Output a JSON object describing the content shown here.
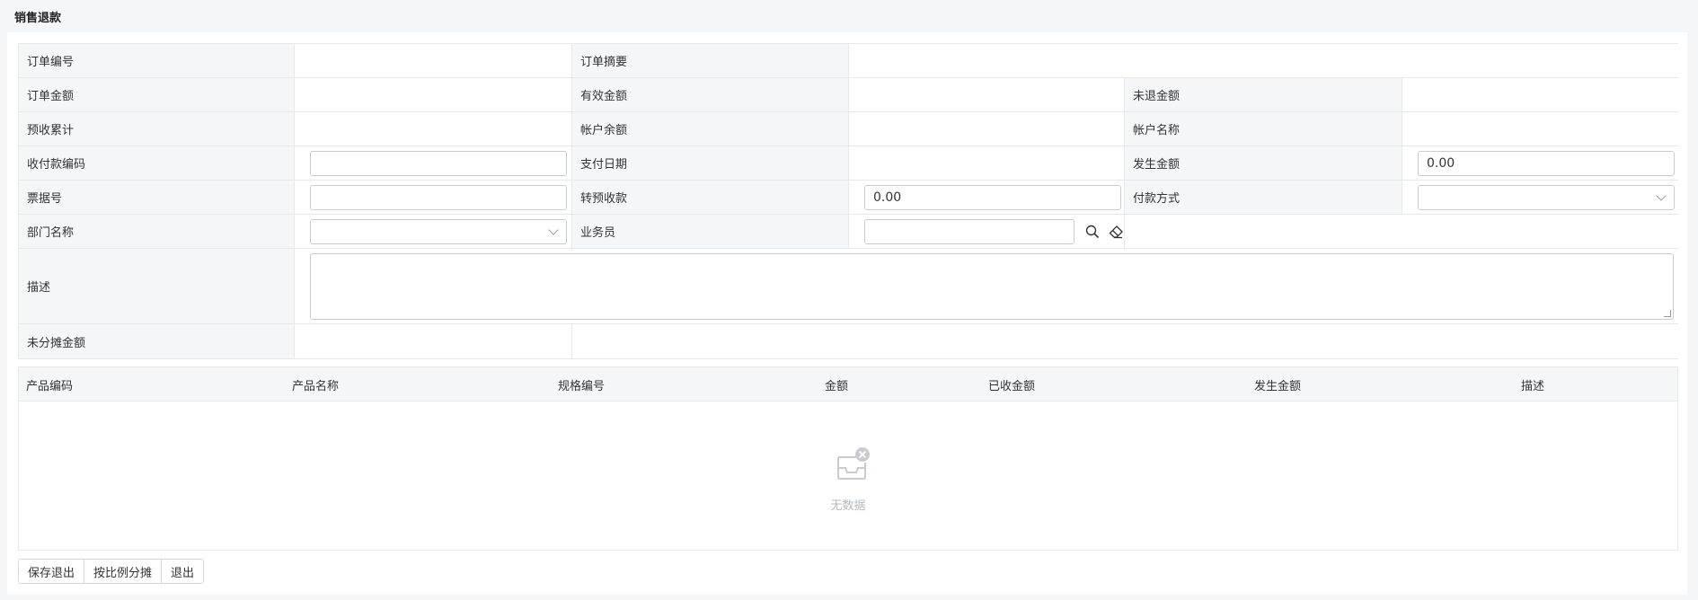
{
  "page": {
    "title": "销售退款"
  },
  "form": {
    "order_no_label": "订单编号",
    "order_summary_label": "订单摘要",
    "order_amount_label": "订单金额",
    "valid_amount_label": "有效金额",
    "unrefunded_amount_label": "未退金额",
    "prepaid_total_label": "预收累计",
    "account_balance_label": "帐户余额",
    "account_name_label": "帐户名称",
    "payment_code_label": "收付款编码",
    "payment_date_label": "支付日期",
    "occur_amount_label": "发生金额",
    "occur_amount_value": "0.00",
    "bill_no_label": "票据号",
    "transfer_prepaid_label": "转预收款",
    "transfer_prepaid_value": "0.00",
    "payment_method_label": "付款方式",
    "department_label": "部门名称",
    "salesman_label": "业务员",
    "description_label": "描述",
    "unallocated_label": "未分摊金额"
  },
  "grid": {
    "columns": [
      "产品编码",
      "产品名称",
      "规格编号",
      "金额",
      "已收金额",
      "发生金额",
      "描述"
    ],
    "rows": [],
    "empty_text": "无数据"
  },
  "actions": {
    "save_exit": "保存退出",
    "allocate_by_ratio": "按比例分摊",
    "exit": "退出"
  },
  "icons": {
    "search": "search-icon",
    "clear": "eraser-icon",
    "dropdown": "chevron-down-icon",
    "empty": "empty-inbox-icon"
  }
}
